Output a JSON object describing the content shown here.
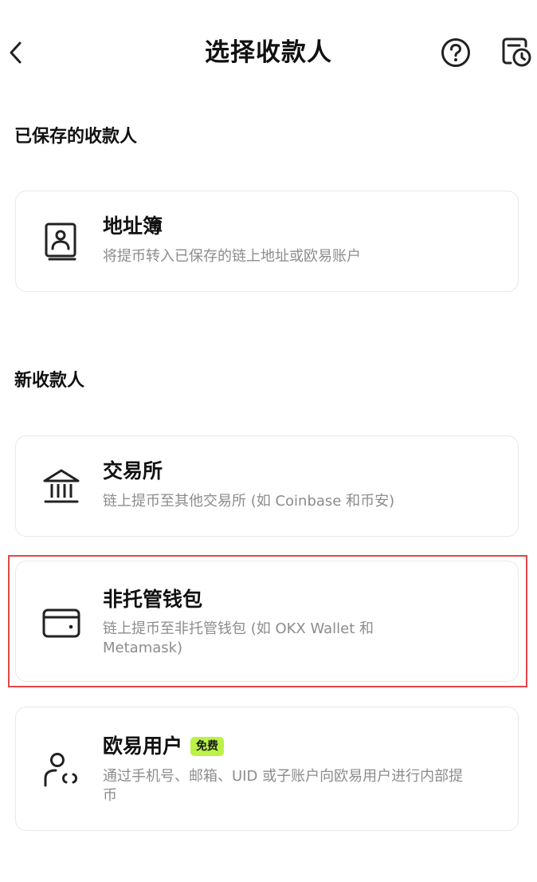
{
  "header": {
    "title": "选择收款人",
    "back_icon": "chevron-left-icon",
    "help_icon": "help-circle-icon",
    "history_icon": "history-icon"
  },
  "saved_section": {
    "title": "已保存的收款人",
    "cards": [
      {
        "icon": "address-book-icon",
        "title": "地址簿",
        "desc": "将提币转入已保存的链上地址或欧易账户"
      }
    ]
  },
  "new_section": {
    "title": "新收款人",
    "cards": [
      {
        "icon": "bank-icon",
        "title": "交易所",
        "desc": "链上提币至其他交易所 (如 Coinbase 和币安)"
      },
      {
        "icon": "wallet-icon",
        "title": "非托管钱包",
        "desc": "链上提币至非托管钱包 (如 OKX Wallet 和 Metamask)"
      },
      {
        "icon": "user-transfer-icon",
        "title": "欧易用户",
        "badge": "免费",
        "desc": "通过手机号、邮箱、UID 或子账户向欧易用户进行内部提币"
      }
    ]
  },
  "colors": {
    "badge_bg": "#bbf246",
    "highlight_border": "#e04848",
    "desc_text": "#8c8c8c",
    "card_border": "#e8e8e8"
  }
}
